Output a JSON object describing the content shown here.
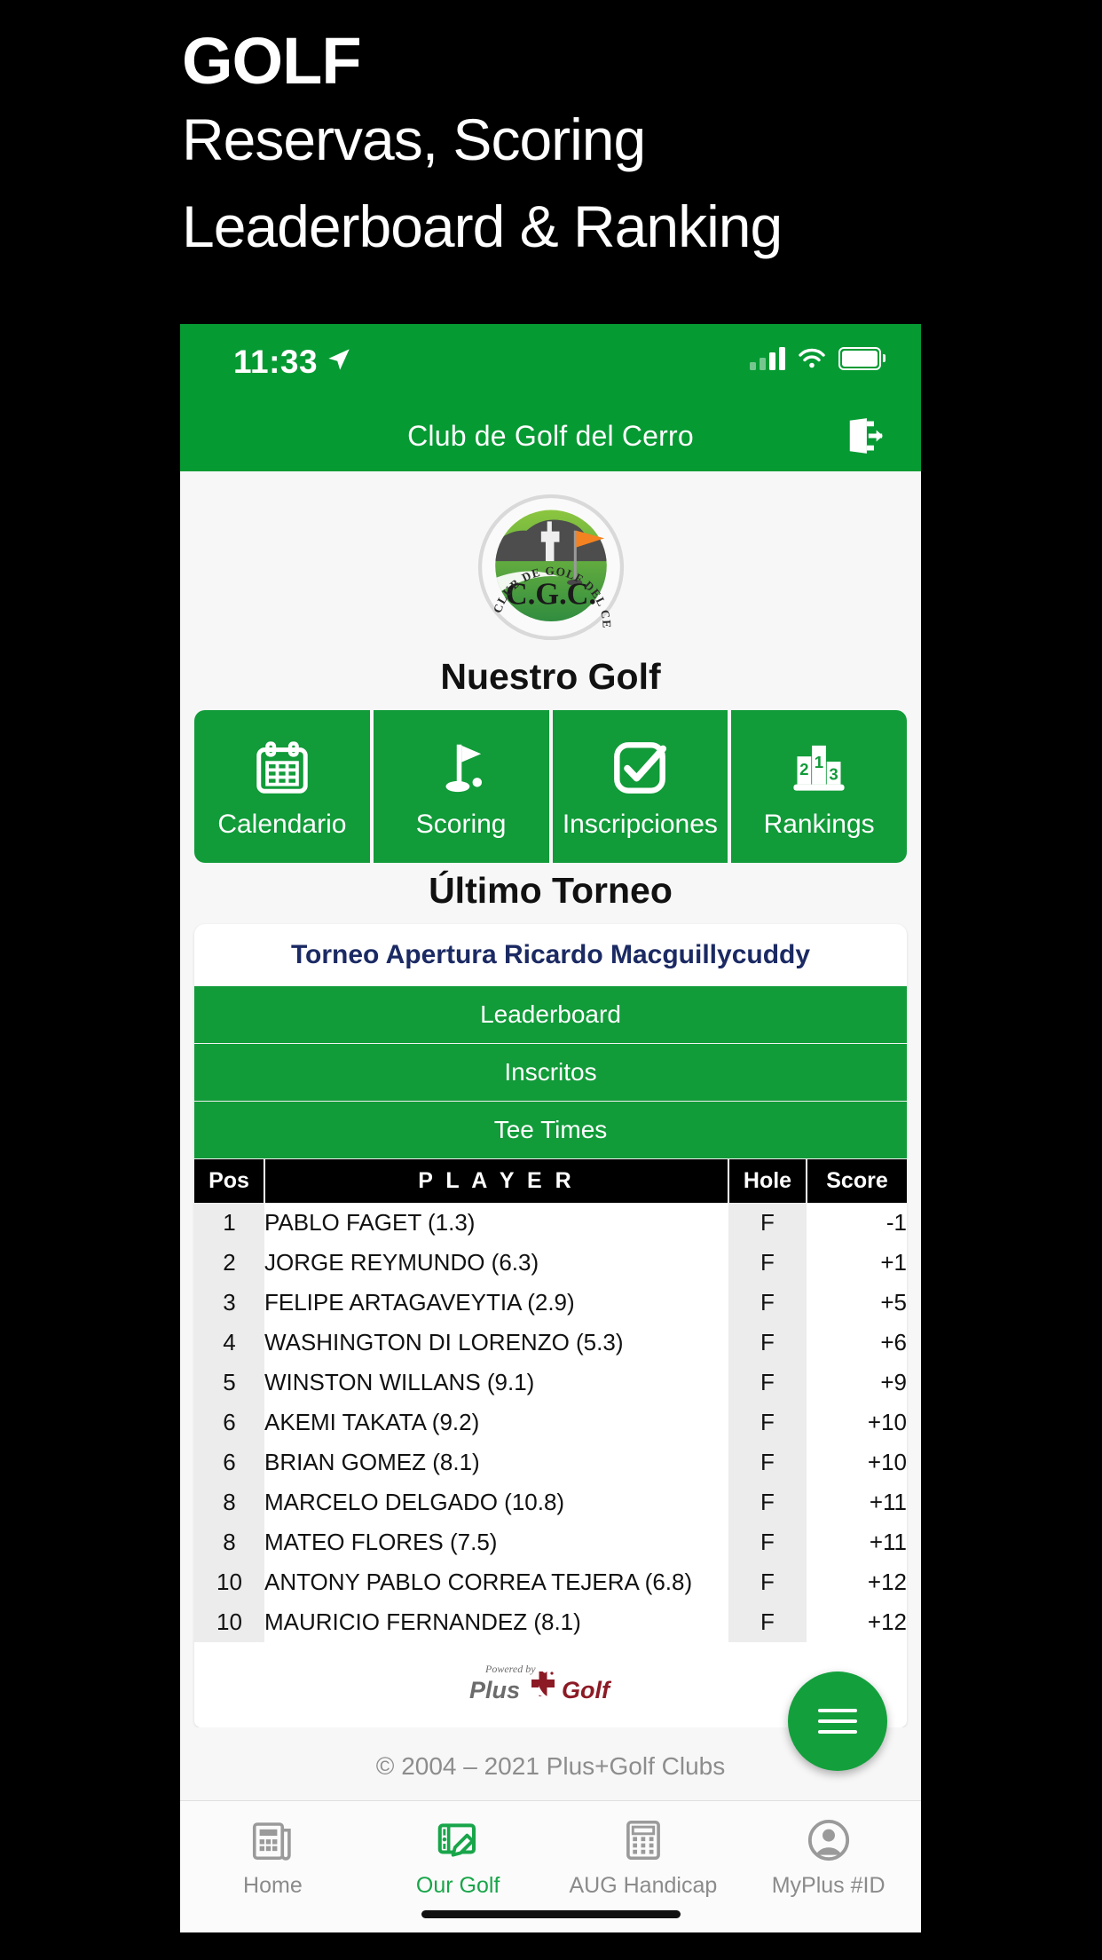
{
  "promo": {
    "title": "GOLF",
    "line1": "Reservas, Scoring",
    "line2": "Leaderboard & Ranking"
  },
  "colors": {
    "brand_green": "#069A33",
    "button_green": "#119B39",
    "tab_active": "#19A54A",
    "card_title_navy": "#1b2a63",
    "logo_red": "#8c1a25"
  },
  "status_bar": {
    "time": "11:33",
    "location_icon": "location-arrow-icon",
    "signal_icon": "cellular-signal-icon",
    "wifi_icon": "wifi-icon",
    "battery_icon": "battery-full-icon"
  },
  "navbar": {
    "title": "Club de Golf del Cerro",
    "logout_icon": "logout-icon"
  },
  "club_logo": {
    "initials": "C.G.C.",
    "ring_text": "CLUB DE GOLF DEL CERRO",
    "alt": "club-de-golf-del-cerro-logo"
  },
  "sections": {
    "our_golf_title": "Nuestro Golf",
    "last_tournament_title": "Último Torneo"
  },
  "quick_buttons": [
    {
      "label": "Calendario",
      "icon": "calendar-icon"
    },
    {
      "label": "Scoring",
      "icon": "golf-flag-icon"
    },
    {
      "label": "Inscripciones",
      "icon": "checkbox-check-icon"
    },
    {
      "label": "Rankings",
      "icon": "podium-icon"
    }
  ],
  "tournament": {
    "name": "Torneo Apertura Ricardo Macguillycuddy",
    "tabs": [
      {
        "label": "Leaderboard"
      },
      {
        "label": "Inscritos"
      },
      {
        "label": "Tee Times"
      }
    ],
    "table": {
      "headers": {
        "pos": "Pos",
        "player": "P L A Y E R",
        "hole": "Hole",
        "score": "Score"
      },
      "rows": [
        {
          "pos": "1",
          "player": "PABLO FAGET (1.3)",
          "hole": "F",
          "score": "-1"
        },
        {
          "pos": "2",
          "player": "JORGE REYMUNDO (6.3)",
          "hole": "F",
          "score": "+1"
        },
        {
          "pos": "3",
          "player": "FELIPE ARTAGAVEYTIA (2.9)",
          "hole": "F",
          "score": "+5"
        },
        {
          "pos": "4",
          "player": "WASHINGTON DI LORENZO (5.3)",
          "hole": "F",
          "score": "+6"
        },
        {
          "pos": "5",
          "player": "WINSTON WILLANS (9.1)",
          "hole": "F",
          "score": "+9"
        },
        {
          "pos": "6",
          "player": "AKEMI TAKATA (9.2)",
          "hole": "F",
          "score": "+10"
        },
        {
          "pos": "6",
          "player": "BRIAN GOMEZ (8.1)",
          "hole": "F",
          "score": "+10"
        },
        {
          "pos": "8",
          "player": "MARCELO DELGADO (10.8)",
          "hole": "F",
          "score": "+11"
        },
        {
          "pos": "8",
          "player": "MATEO FLORES (7.5)",
          "hole": "F",
          "score": "+11"
        },
        {
          "pos": "10",
          "player": "ANTONY PABLO CORREA TEJERA (6.8)",
          "hole": "F",
          "score": "+12"
        },
        {
          "pos": "10",
          "player": "MAURICIO FERNANDEZ (8.1)",
          "hole": "F",
          "score": "+12"
        }
      ]
    }
  },
  "powered_by": {
    "prefix": "Powered by",
    "word1": "Plus",
    "word2": "Golf"
  },
  "footer": {
    "copyright": "© 2004 – 2021 Plus+Golf Clubs"
  },
  "fab": {
    "icon": "hamburger-menu-icon"
  },
  "tabbar": [
    {
      "label": "Home",
      "icon": "news-icon",
      "active": false
    },
    {
      "label": "Our Golf",
      "icon": "scorecard-pen-icon",
      "active": true
    },
    {
      "label": "AUG Handicap",
      "icon": "calculator-icon",
      "active": false
    },
    {
      "label": "MyPlus #ID",
      "icon": "user-avatar-icon",
      "active": false
    }
  ]
}
